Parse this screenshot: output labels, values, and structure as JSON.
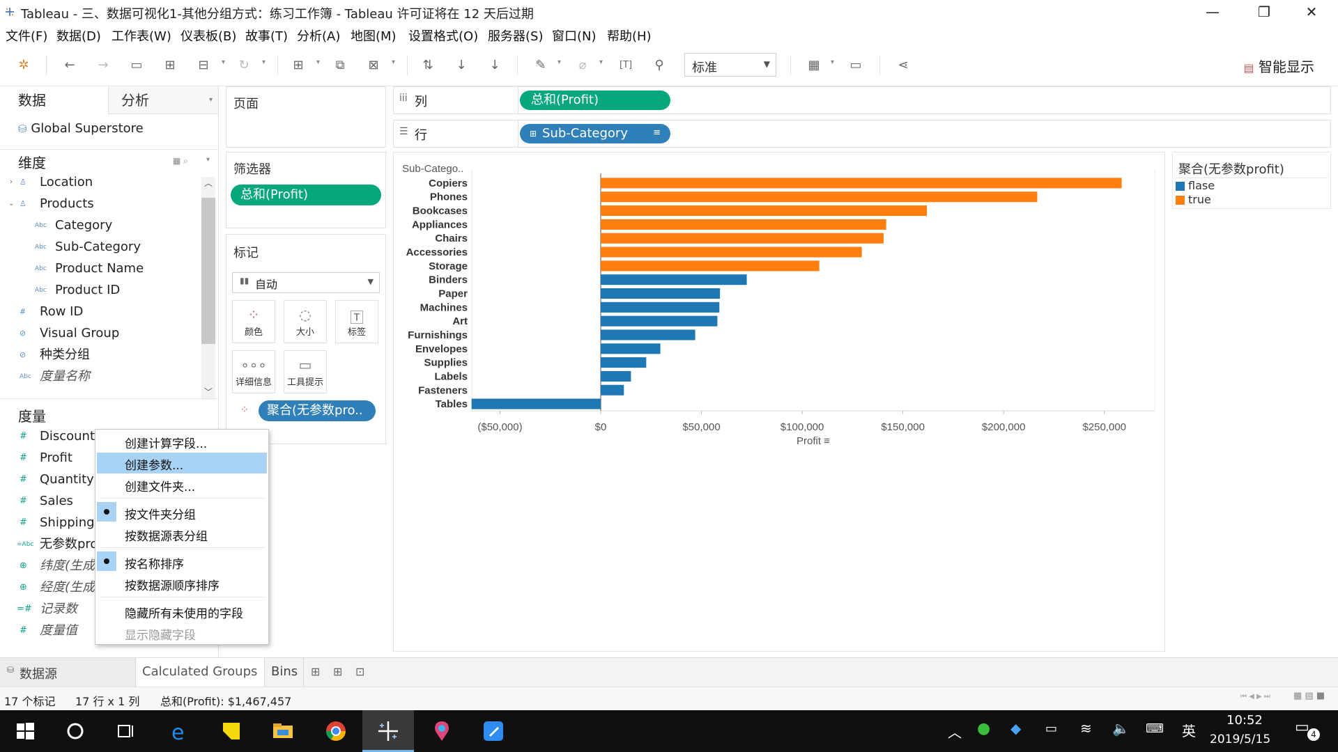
{
  "window": {
    "title": "Tableau - 三、数据可视化1-其他分组方式：练习工作簿 - Tableau 许可证将在 12 天后过期",
    "minimize": "—",
    "maximize": "❐",
    "close": "✕"
  },
  "menu": [
    "文件(F)",
    "数据(D)",
    "工作表(W)",
    "仪表板(B)",
    "故事(T)",
    "分析(A)",
    "地图(M)",
    "设置格式(O)",
    "服务器(S)",
    "窗口(N)",
    "帮助(H)"
  ],
  "toolbar": {
    "fit_select": "标准",
    "smart_show": "智能显示"
  },
  "datapane": {
    "tab_data": "数据",
    "tab_analysis": "分析",
    "datasource": "Global Superstore",
    "dimensions_header": "维度",
    "dimensions": [
      {
        "label": "Location",
        "icon": "folder-hierarchy-icon"
      },
      {
        "label": "Products",
        "icon": "folder-hierarchy-icon"
      },
      {
        "label": "Category",
        "icon": "abc"
      },
      {
        "label": "Sub-Category",
        "icon": "abc"
      },
      {
        "label": "Product Name",
        "icon": "abc"
      },
      {
        "label": "Product ID",
        "icon": "abc"
      },
      {
        "label": "Row ID",
        "icon": "#"
      },
      {
        "label": "Visual Group",
        "icon": "paperclip-icon"
      },
      {
        "label": "种类分组",
        "icon": "paperclip-icon"
      },
      {
        "label": "度量名称",
        "icon": "abc"
      }
    ],
    "measures_header": "度量",
    "measures": [
      {
        "label": "Discount",
        "icon": "#"
      },
      {
        "label": "Profit",
        "icon": "#"
      },
      {
        "label": "Quantity",
        "icon": "#"
      },
      {
        "label": "Sales",
        "icon": "#"
      },
      {
        "label": "Shipping",
        "icon": "#"
      },
      {
        "label": "无参数pro",
        "icon": "=abc"
      },
      {
        "label": "纬度(生成",
        "icon": "globe"
      },
      {
        "label": "经度(生成",
        "icon": "globe"
      },
      {
        "label": "记录数",
        "icon": "=#"
      },
      {
        "label": "度量值",
        "icon": "#"
      }
    ]
  },
  "shelves": {
    "pages_label": "页面",
    "filters_label": "筛选器",
    "filter_pill": "总和(Profit)",
    "marks_label": "标记",
    "mark_type": "自动",
    "mark_buttons": [
      "颜色",
      "大小",
      "标签",
      "详细信息",
      "工具提示"
    ],
    "color_pill": "聚合(无参数pro..",
    "columns_label": "列",
    "rows_label": "行",
    "columns_pill": "总和(Profit)",
    "rows_pill": "Sub-Category"
  },
  "context_menu": {
    "items": [
      "创建计算字段...",
      "创建参数...",
      "创建文件夹...",
      "按文件夹分组",
      "按数据源表分组",
      "按名称排序",
      "按数据源顺序排序",
      "隐藏所有未使用的字段",
      "显示隐藏字段"
    ],
    "highlighted": "创建参数..."
  },
  "legend": {
    "title": "聚合(无参数profit)",
    "items": [
      {
        "label": "flase",
        "color": "#1f77b4"
      },
      {
        "label": "true",
        "color": "#ff7f0e"
      }
    ]
  },
  "chart_data": {
    "type": "bar",
    "orientation": "horizontal",
    "row_header": "Sub-Catego..",
    "xlabel": "Profit",
    "xlim": [
      -64000,
      275000
    ],
    "x_ticks": [
      "($50,000)",
      "$0",
      "$50,000",
      "$100,000",
      "$150,000",
      "$200,000",
      "$250,000"
    ],
    "x_tick_values": [
      -50000,
      0,
      50000,
      100000,
      150000,
      200000,
      250000
    ],
    "categories": [
      "Copiers",
      "Phones",
      "Bookcases",
      "Appliances",
      "Chairs",
      "Accessories",
      "Storage",
      "Binders",
      "Paper",
      "Machines",
      "Art",
      "Furnishings",
      "Envelopes",
      "Supplies",
      "Labels",
      "Fasteners",
      "Tables"
    ],
    "values": [
      258600,
      216700,
      161900,
      141700,
      140400,
      129600,
      108500,
      72500,
      59200,
      58900,
      57900,
      46900,
      29600,
      22600,
      15000,
      11500,
      -64100
    ],
    "group": [
      "true",
      "true",
      "true",
      "true",
      "true",
      "true",
      "true",
      "flase",
      "flase",
      "flase",
      "flase",
      "flase",
      "flase",
      "flase",
      "flase",
      "flase",
      "flase"
    ],
    "colors": {
      "true": "#ff7f0e",
      "flase": "#1f77b4"
    }
  },
  "sheet_tabs": {
    "datasource": "数据源",
    "sheets": [
      "Calculated Groups",
      "Bins"
    ]
  },
  "status": {
    "marks": "17 个标记",
    "rows_cols": "17 行 x 1 列",
    "sum": "总和(Profit): $1,467,457"
  },
  "taskbar": {
    "ime": "英",
    "time": "10:52",
    "date": "2019/5/15",
    "notifications": "4"
  }
}
